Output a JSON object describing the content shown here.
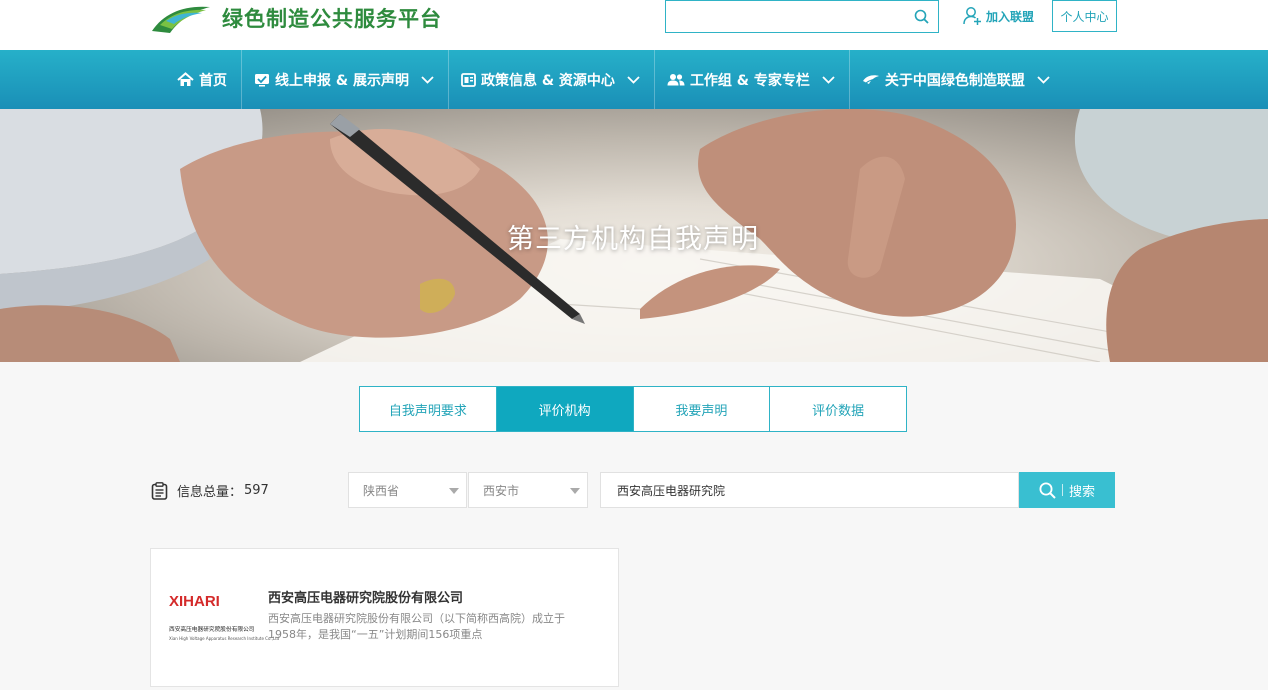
{
  "header": {
    "site_title": "绿色制造公共服务平台",
    "search_placeholder": "",
    "join_label": "加入联盟",
    "personal_label": "个人中心"
  },
  "nav": {
    "items": [
      {
        "label": "首页",
        "icon": "home-icon"
      },
      {
        "label": "线上申报 & 展示声明",
        "icon": "checkmark-box-icon"
      },
      {
        "label": "政策信息 & 资源中心",
        "icon": "document-icon"
      },
      {
        "label": "工作组 & 专家专栏",
        "icon": "users-icon"
      },
      {
        "label": "关于中国绿色制造联盟",
        "icon": "leaf-icon"
      }
    ]
  },
  "banner": {
    "title": "第三方机构自我声明"
  },
  "tabs": [
    {
      "label": "自我声明要求",
      "active": false
    },
    {
      "label": "评价机构",
      "active": true
    },
    {
      "label": "我要声明",
      "active": false
    },
    {
      "label": "评价数据",
      "active": false
    }
  ],
  "filter": {
    "total_label": "信息总量：",
    "total_value": "597",
    "province": "陕西省",
    "city": "西安市",
    "keyword": "西安高压电器研究院",
    "search_label": "搜索"
  },
  "results": [
    {
      "logo_brand": "XIHARI",
      "logo_cn": "西安高压电器研究院股份有限公司",
      "logo_en": "Xian High Voltage Apparatus Research Institute Co.,Ltd",
      "name": "西安高压电器研究院股份有限公司",
      "description": "西安高压电器研究院股份有限公司（以下简称西高院）成立于1958年，是我国“一五”计划期间156项重点"
    }
  ],
  "colors": {
    "accent": "#23a4b8",
    "nav_top": "#26b0c9",
    "nav_bottom": "#1a8fb7",
    "active_tab": "#0fa8bf",
    "search_button": "#39bfd1",
    "brand_green": "#2e8b3e",
    "logo_red": "#d42a2a"
  }
}
